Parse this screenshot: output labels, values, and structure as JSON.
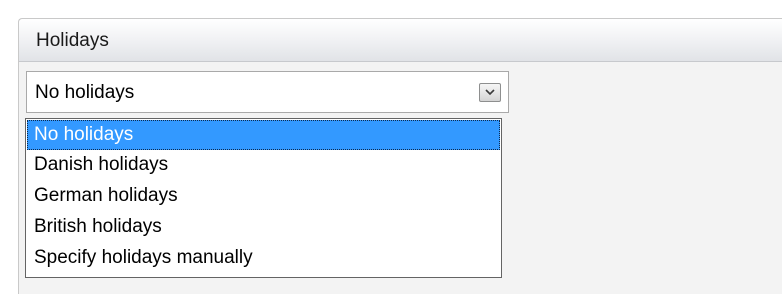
{
  "panel": {
    "title": "Holidays"
  },
  "combo": {
    "value": "No holidays",
    "button_icon": "chevron-down-icon"
  },
  "dropdown": {
    "selected_index": 0,
    "options": [
      "No holidays",
      "Danish holidays",
      "German holidays",
      "British holidays",
      "Specify holidays manually"
    ]
  },
  "colors": {
    "selection": "#3399ff",
    "selection_text": "#ffffff"
  }
}
